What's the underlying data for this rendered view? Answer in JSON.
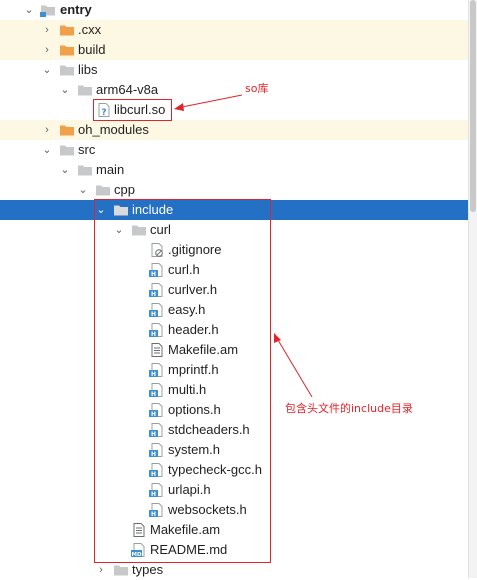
{
  "tree": {
    "entry": "entry",
    "cxx": ".cxx",
    "build": "build",
    "libs": "libs",
    "arm64": "arm64-v8a",
    "libcurl": "libcurl.so",
    "oh_modules": "oh_modules",
    "src": "src",
    "main": "main",
    "cpp": "cpp",
    "include": "include",
    "curl": "curl",
    "files": [
      ".gitignore",
      "curl.h",
      "curlver.h",
      "easy.h",
      "header.h",
      "Makefile.am",
      "mprintf.h",
      "multi.h",
      "options.h",
      "stdcheaders.h",
      "system.h",
      "typecheck-gcc.h",
      "urlapi.h",
      "websockets.h"
    ],
    "include_makefile": "Makefile.am",
    "readme": "README.md",
    "types": "types"
  },
  "annotations": {
    "so_label": "so库",
    "include_label": "包含头文件的include目录"
  },
  "colors": {
    "selection": "#2470c4",
    "highlight_row": "#fdf8e3",
    "annotation": "#e0242b",
    "folder": "#c7c8ca",
    "folder_excluded": "#f0a04b",
    "header_icon": "#3d8fd1"
  }
}
